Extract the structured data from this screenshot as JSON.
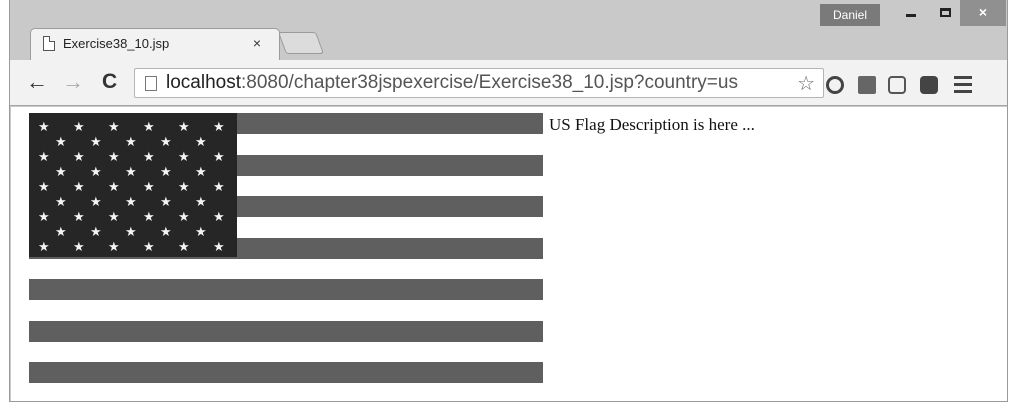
{
  "browser": {
    "tab_title": "Exercise38_10.jsp",
    "tab_close": "×",
    "profile_name": "Daniel",
    "close_glyph": "×",
    "url_host": "localhost",
    "url_rest": ":8080/chapter38jspexercise/Exercise38_10.jsp?country=us",
    "back_glyph": "←",
    "forward_glyph": "→",
    "reload_glyph": "C",
    "bookmark_glyph": "☆"
  },
  "page": {
    "description": "US Flag Description is here ..."
  },
  "flag": {
    "stripe_color": "#5f5f5f",
    "canton_color": "#262626",
    "star_color": "#f4f4f4",
    "star_glyph": "★"
  }
}
